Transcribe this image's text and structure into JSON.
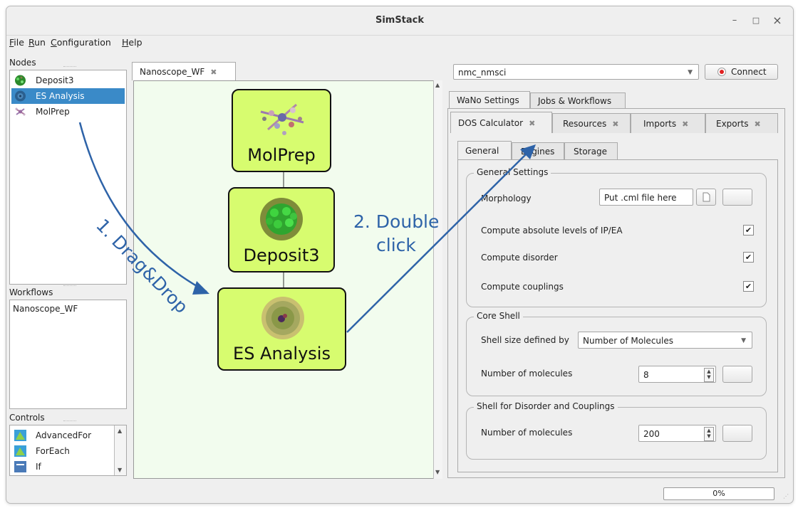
{
  "window": {
    "title": "SimStack",
    "minimize": "–",
    "maximize": "□",
    "close": "×"
  },
  "menu": [
    {
      "label": "File",
      "mnemonic": "F",
      "rest": "ile"
    },
    {
      "label": "Run",
      "mnemonic": "R",
      "rest": "un"
    },
    {
      "label": "Configuration",
      "mnemonic": "C",
      "rest": "onfiguration"
    },
    {
      "label": "Help",
      "mnemonic": "H",
      "rest": "elp"
    }
  ],
  "left": {
    "nodes_label": "Nodes",
    "nodes": [
      {
        "label": "Deposit3",
        "icon": "deposit-molecule-icon",
        "selected": false
      },
      {
        "label": "ES Analysis",
        "icon": "es-analysis-molecule-icon",
        "selected": true
      },
      {
        "label": "MolPrep",
        "icon": "molprep-molecule-icon",
        "selected": false
      }
    ],
    "workflows_label": "Workflows",
    "workflows": [
      "Nanoscope_WF"
    ],
    "controls_label": "Controls",
    "controls": [
      {
        "label": "AdvancedFor",
        "icon": "advancedfor-icon"
      },
      {
        "label": "ForEach",
        "icon": "foreach-icon"
      },
      {
        "label": "If",
        "icon": "if-icon"
      }
    ]
  },
  "editor": {
    "tab_label": "Nanoscope_WF",
    "nodes": [
      "MolPrep",
      "Deposit3",
      "ES Analysis"
    ]
  },
  "annotations": {
    "drag": "1. Drag&Drop",
    "double_line1": "2. Double",
    "double_line2": "click"
  },
  "right": {
    "server": "nmc_nmsci",
    "connect_label": "Connect",
    "connect_status_color": "#e02020",
    "top_tabs": [
      "WaNo Settings",
      "Jobs & Workflows"
    ],
    "wano_tabs": [
      "DOS Calculator",
      "Resources",
      "Imports",
      "Exports"
    ],
    "sub_tabs": [
      "General",
      "Engines",
      "Storage"
    ],
    "general_settings": {
      "title": "General Settings",
      "morphology_label": "Morphology",
      "morphology_placeholder": "Put .cml file here",
      "ip_ea_label": "Compute absolute levels of IP/EA",
      "ip_ea_checked": true,
      "disorder_label": "Compute disorder",
      "disorder_checked": true,
      "couplings_label": "Compute couplings",
      "couplings_checked": true
    },
    "core_shell": {
      "title": "Core Shell",
      "shell_size_label": "Shell size defined by",
      "shell_size_value": "Number of Molecules",
      "num_molecules_label": "Number of molecules",
      "num_molecules_value": "8"
    },
    "shell_disorder": {
      "title": "Shell for Disorder and Couplings",
      "num_molecules_label": "Number of molecules",
      "num_molecules_value": "200"
    }
  },
  "status": {
    "progress_text": "0%"
  }
}
